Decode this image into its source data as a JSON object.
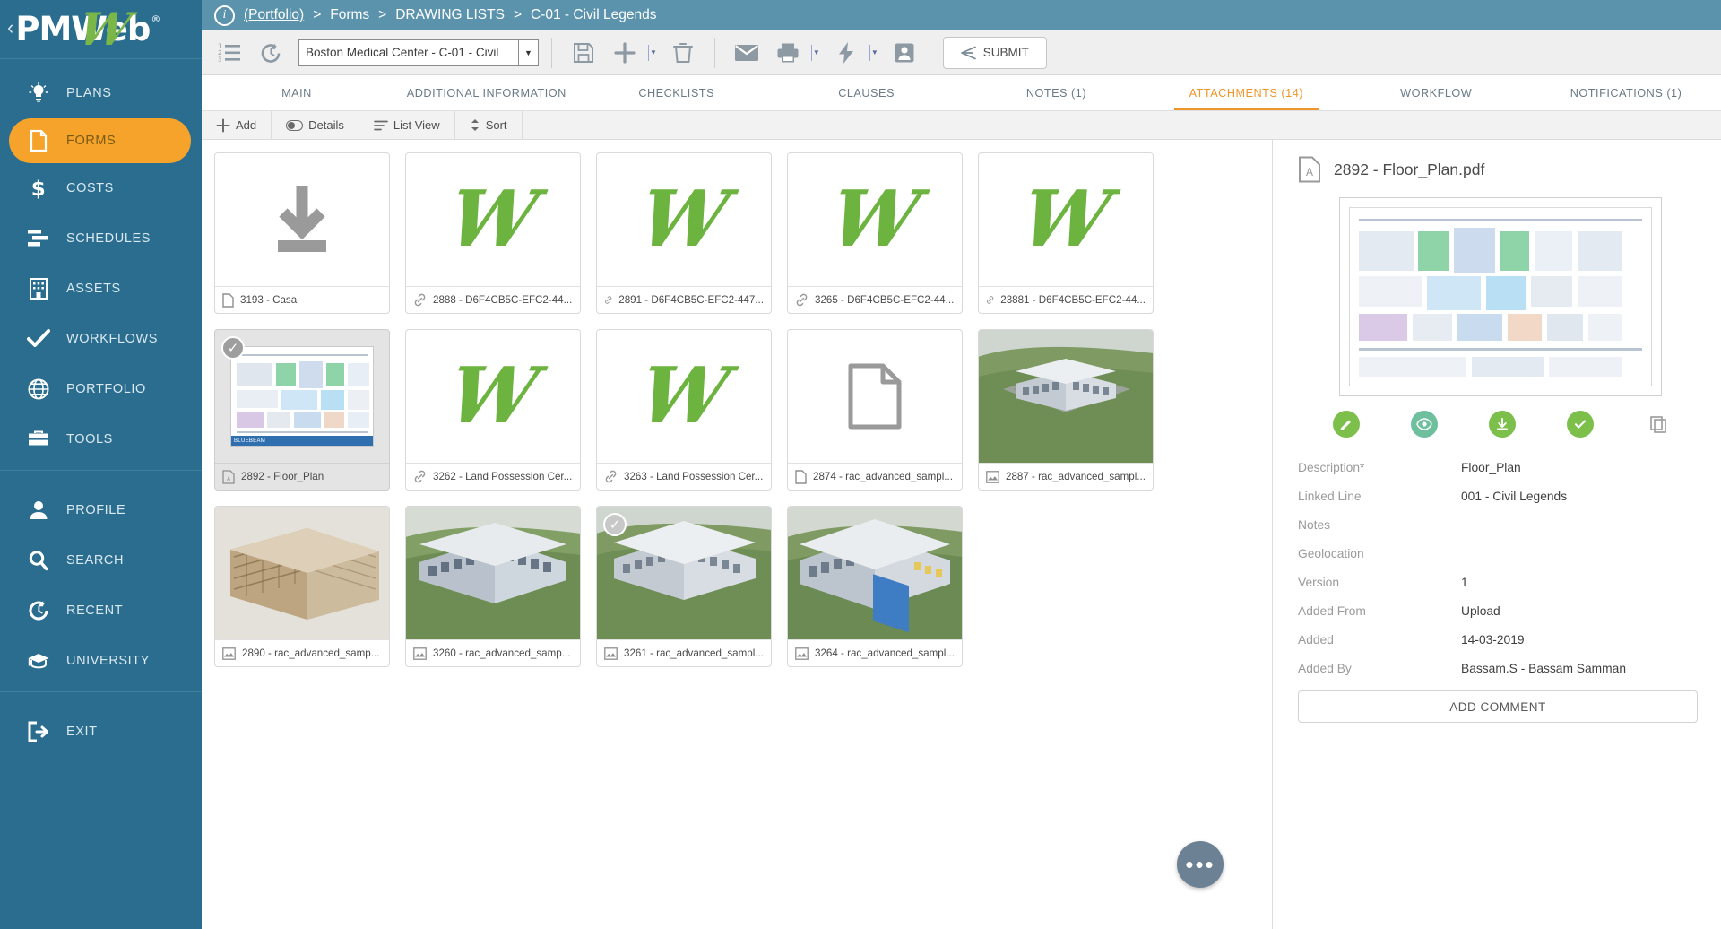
{
  "brand": {
    "logo_pm": "PM",
    "logo_web": "Web",
    "registered": "®",
    "collapse": "‹",
    "accent_orange": "#f5a32a",
    "accent_green": "#7ab648",
    "sidebar_bg": "#2a6d8f",
    "breadcrumb_bg": "#5b93ad"
  },
  "sidebar": {
    "items": [
      {
        "label": "PLANS",
        "icon": "lightbulb-icon",
        "active": false
      },
      {
        "label": "FORMS",
        "icon": "document-icon",
        "active": true
      },
      {
        "label": "COSTS",
        "icon": "dollar-icon",
        "active": false
      },
      {
        "label": "SCHEDULES",
        "icon": "schedule-bars-icon",
        "active": false
      },
      {
        "label": "ASSETS",
        "icon": "building-icon",
        "active": false
      },
      {
        "label": "WORKFLOWS",
        "icon": "checkmark-icon",
        "active": false
      },
      {
        "label": "PORTFOLIO",
        "icon": "globe-icon",
        "active": false
      },
      {
        "label": "TOOLS",
        "icon": "toolbox-icon",
        "active": false
      }
    ],
    "items_secondary": [
      {
        "label": "PROFILE",
        "icon": "user-icon"
      },
      {
        "label": "SEARCH",
        "icon": "magnifier-icon"
      },
      {
        "label": "RECENT",
        "icon": "history-icon"
      },
      {
        "label": "UNIVERSITY",
        "icon": "graduation-cap-icon"
      }
    ],
    "items_tertiary": [
      {
        "label": "EXIT",
        "icon": "exit-icon"
      }
    ]
  },
  "breadcrumb": {
    "info_glyph": "i",
    "parts": [
      "(Portfolio)",
      "Forms",
      "DRAWING LISTS",
      "C-01 - Civil Legends"
    ],
    "separator": ">"
  },
  "toolbar": {
    "buttons": [
      {
        "name": "numbered-list-icon",
        "glyph": "list"
      },
      {
        "name": "history-revert-icon",
        "glyph": "revert"
      }
    ],
    "project_select": {
      "value": "Boston Medical Center - C-01 - Civil",
      "arrow": "▼"
    },
    "actions": [
      {
        "name": "save-icon"
      },
      {
        "name": "add-icon"
      },
      {
        "name": "delete-icon"
      },
      {
        "name": "email-icon"
      },
      {
        "name": "print-icon"
      },
      {
        "name": "lightning-icon"
      },
      {
        "name": "contact-icon"
      }
    ],
    "submit_label": "SUBMIT"
  },
  "tabs": [
    {
      "label": "MAIN",
      "active": false
    },
    {
      "label": "ADDITIONAL INFORMATION",
      "active": false
    },
    {
      "label": "CHECKLISTS",
      "active": false
    },
    {
      "label": "CLAUSES",
      "active": false
    },
    {
      "label": "NOTES (1)",
      "active": false
    },
    {
      "label": "ATTACHMENTS (14)",
      "active": true
    },
    {
      "label": "WORKFLOW",
      "active": false
    },
    {
      "label": "NOTIFICATIONS (1)",
      "active": false
    }
  ],
  "subbar": {
    "add_label": "Add",
    "details_label": "Details",
    "list_view_label": "List View",
    "sort_label": "Sort"
  },
  "attachments": [
    {
      "id": "3193",
      "caption": "3193 - Casa",
      "icon": "file-icon",
      "thumb": "download",
      "selected": false
    },
    {
      "id": "2888",
      "caption": "2888 - D6F4CB5C-EFC2-44...",
      "icon": "link-icon",
      "thumb": "swoosh",
      "selected": false
    },
    {
      "id": "2891",
      "caption": "2891 - D6F4CB5C-EFC2-447...",
      "icon": "link-icon",
      "thumb": "swoosh",
      "selected": false
    },
    {
      "id": "3265",
      "caption": "3265 - D6F4CB5C-EFC2-44...",
      "icon": "link-icon",
      "thumb": "swoosh",
      "selected": false
    },
    {
      "id": "23881",
      "caption": "23881 - D6F4CB5C-EFC2-44...",
      "icon": "link-icon",
      "thumb": "swoosh",
      "selected": false
    },
    {
      "id": "2892",
      "caption": "2892 - Floor_Plan",
      "icon": "pdf-icon",
      "thumb": "floorplan",
      "selected": true
    },
    {
      "id": "3262",
      "caption": "3262 - Land Possession Cer...",
      "icon": "link-icon",
      "thumb": "swoosh",
      "selected": false
    },
    {
      "id": "3263",
      "caption": "3263 - Land Possession Cer...",
      "icon": "link-icon",
      "thumb": "swoosh",
      "selected": false
    },
    {
      "id": "2874",
      "caption": "2874 - rac_advanced_sampl...",
      "icon": "file-icon",
      "thumb": "blank-doc",
      "selected": false
    },
    {
      "id": "2887",
      "caption": "2887 - rac_advanced_sampl...",
      "icon": "image-icon",
      "thumb": "building-courtyard",
      "selected": false
    },
    {
      "id": "2890",
      "caption": "2890 - rac_advanced_samp...",
      "icon": "image-icon",
      "thumb": "building-timber",
      "selected": false
    },
    {
      "id": "3260",
      "caption": "3260 - rac_advanced_samp...",
      "icon": "image-icon",
      "thumb": "building-office",
      "selected": false
    },
    {
      "id": "3261",
      "caption": "3261 - rac_advanced_sampl...",
      "icon": "image-icon",
      "thumb": "building-courtyard",
      "selected": true
    },
    {
      "id": "3264",
      "caption": "3264 - rac_advanced_sampl...",
      "icon": "image-icon",
      "thumb": "building-blue",
      "selected": false
    }
  ],
  "fab": {
    "glyph": "•••"
  },
  "details": {
    "file_name": "2892 - Floor_Plan.pdf",
    "file_icon": "pdf-icon",
    "preview_tag": "BLUEBEAM",
    "actions": [
      {
        "name": "edit-action",
        "style": "green"
      },
      {
        "name": "view-action",
        "style": "teal"
      },
      {
        "name": "download-action",
        "style": "green"
      },
      {
        "name": "approve-action",
        "style": "green"
      },
      {
        "name": "copy-action",
        "style": "grey"
      }
    ],
    "fields": [
      {
        "label": "Description*",
        "value": "Floor_Plan"
      },
      {
        "label": "Linked Line",
        "value": "001 - Civil Legends"
      },
      {
        "label": "Notes",
        "value": ""
      },
      {
        "label": "Geolocation",
        "value": ""
      },
      {
        "label": "Version",
        "value": "1"
      },
      {
        "label": "Added From",
        "value": "Upload"
      },
      {
        "label": "Added",
        "value": "14-03-2019"
      },
      {
        "label": "Added By",
        "value": "Bassam.S - Bassam Samman"
      }
    ],
    "add_comment_label": "ADD COMMENT"
  }
}
